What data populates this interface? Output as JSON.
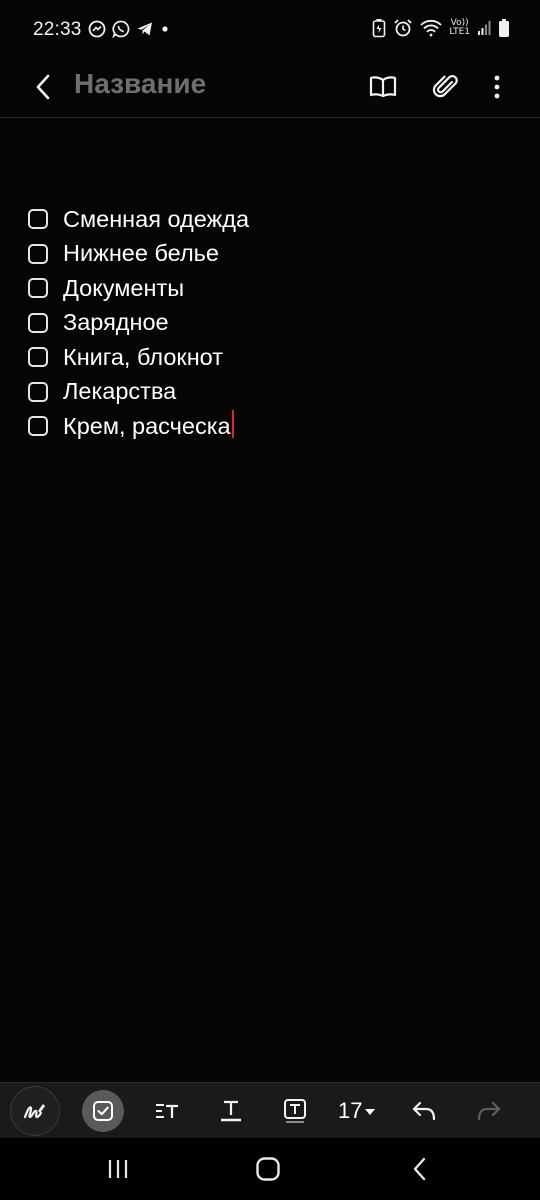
{
  "status_bar": {
    "time": "22:33",
    "lte_top": "Vo))",
    "lte_bottom": "LTE1"
  },
  "header": {
    "title": "Название"
  },
  "checklist": {
    "items": [
      {
        "text": "Сменная одежда",
        "checked": false
      },
      {
        "text": "Нижнее белье",
        "checked": false
      },
      {
        "text": "Документы",
        "checked": false
      },
      {
        "text": "Зарядное",
        "checked": false
      },
      {
        "text": "Книга, блокнот",
        "checked": false
      },
      {
        "text": "Лекарства",
        "checked": false
      },
      {
        "text": "Крем, расческа",
        "checked": false
      }
    ]
  },
  "toolbar": {
    "font_size": "17"
  },
  "colors": {
    "background": "#050505",
    "title_gray": "#6f6f6f",
    "cursor_red": "#e0262b",
    "toolbar_bg": "#1a1a1a",
    "active_button": "#5a5a5a"
  },
  "icons": {
    "status_left": [
      "messenger-icon",
      "whatsapp-icon",
      "telegram-icon",
      "notification-dot-icon"
    ],
    "status_right": [
      "battery-saver-icon",
      "alarm-icon",
      "wifi-icon",
      "volte-icon",
      "signal-icon",
      "battery-icon"
    ],
    "header": [
      "back-icon",
      "book-icon",
      "paperclip-icon",
      "more-vert-icon"
    ],
    "toolbar": [
      "handwriting-icon",
      "checkbox-icon",
      "text-format-icon",
      "underline-text-icon",
      "text-box-icon",
      "undo-icon",
      "redo-icon"
    ],
    "nav": [
      "recents-icon",
      "home-icon",
      "nav-back-icon"
    ]
  }
}
